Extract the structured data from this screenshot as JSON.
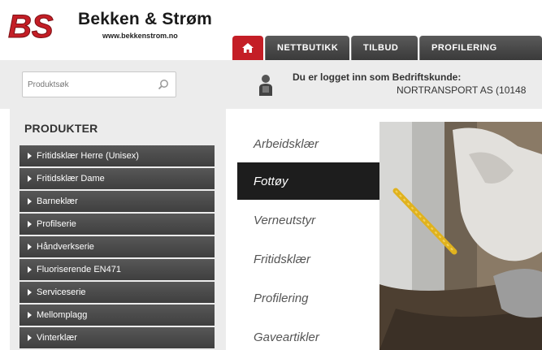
{
  "brand": {
    "logo_mark": "BS",
    "name": "Bekken & Strøm",
    "url": "www.bekkenstrom.no",
    "color_red": "#c41e26"
  },
  "nav": {
    "home_icon": "home-icon",
    "items": [
      "NETTBUTIKK",
      "TILBUD",
      "PROFILERING"
    ]
  },
  "search": {
    "placeholder": "Produktsøk",
    "icon": "search-icon"
  },
  "login": {
    "icon": "user-icon",
    "label": "Du er logget inn som Bedriftskunde:",
    "company": "NORTRANSPORT AS (10148"
  },
  "products": {
    "title": "PRODUKTER",
    "items": [
      "Fritidsklær Herre (Unisex)",
      "Fritidsklær Dame",
      "Barneklær",
      "Profilserie",
      "Håndverkserie",
      "Fluoriserende EN471",
      "Serviceserie",
      "Mellomplagg",
      "Vinterklær"
    ]
  },
  "categories": {
    "items": [
      "Arbeidsklær",
      "Fottøy",
      "Verneutstyr",
      "Fritidsklær",
      "Profilering",
      "Gaveartikler"
    ],
    "active": "Fottøy"
  }
}
